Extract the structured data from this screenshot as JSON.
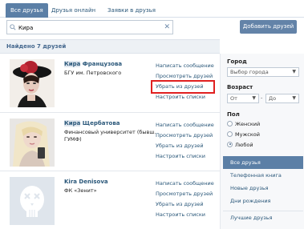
{
  "tabs": [
    {
      "label": "Все друзья"
    },
    {
      "label": "Друзья онлайн"
    },
    {
      "label": "Заявки в друзья"
    }
  ],
  "search": {
    "value": "Кира",
    "placeholder": ""
  },
  "add_friends_button": "Добавить друзей",
  "found_count": "Найдено 7 друзей",
  "friends": [
    {
      "name_highlight": "Кира",
      "name_rest": " Французова",
      "info_line1": "БГУ им. Петровского",
      "info_line2": "",
      "actions": [
        "Написать сообщение",
        "Просмотреть друзей",
        "Убрать из друзей",
        "Настроить списки"
      ]
    },
    {
      "name_highlight": "Кира",
      "name_rest": " Щербатова",
      "info_line1": "Финансовый университет (бывш.",
      "info_line2": "ГУМФ)",
      "actions": [
        "Написать сообщение",
        "Просмотреть друзей",
        "Убрать из друзей",
        "Настроить списки"
      ]
    },
    {
      "name_highlight": "",
      "name_rest": "Kira Denisova",
      "info_line1": "ФК «Зенит»",
      "info_line2": "",
      "actions": [
        "Написать сообщение",
        "Просмотреть друзей",
        "Убрать из друзей",
        "Настроить списки"
      ]
    }
  ],
  "sidebar": {
    "city_label": "Город",
    "city_select": "Выбор города",
    "age_label": "Возраст",
    "age_from": "От",
    "age_dash": "-",
    "age_to": "До",
    "gender_label": "Пол",
    "gender_options": [
      "Женский",
      "Мужской",
      "Любой"
    ],
    "gender_selected": "Любой",
    "menu": [
      "Все друзья",
      "Телефонная книга",
      "Новые друзья",
      "Дни рождения",
      "Лучшие друзья"
    ]
  },
  "colors": {
    "accent": "#5b7fa6",
    "link": "#2b587a",
    "highlight_box": "#e02020"
  }
}
